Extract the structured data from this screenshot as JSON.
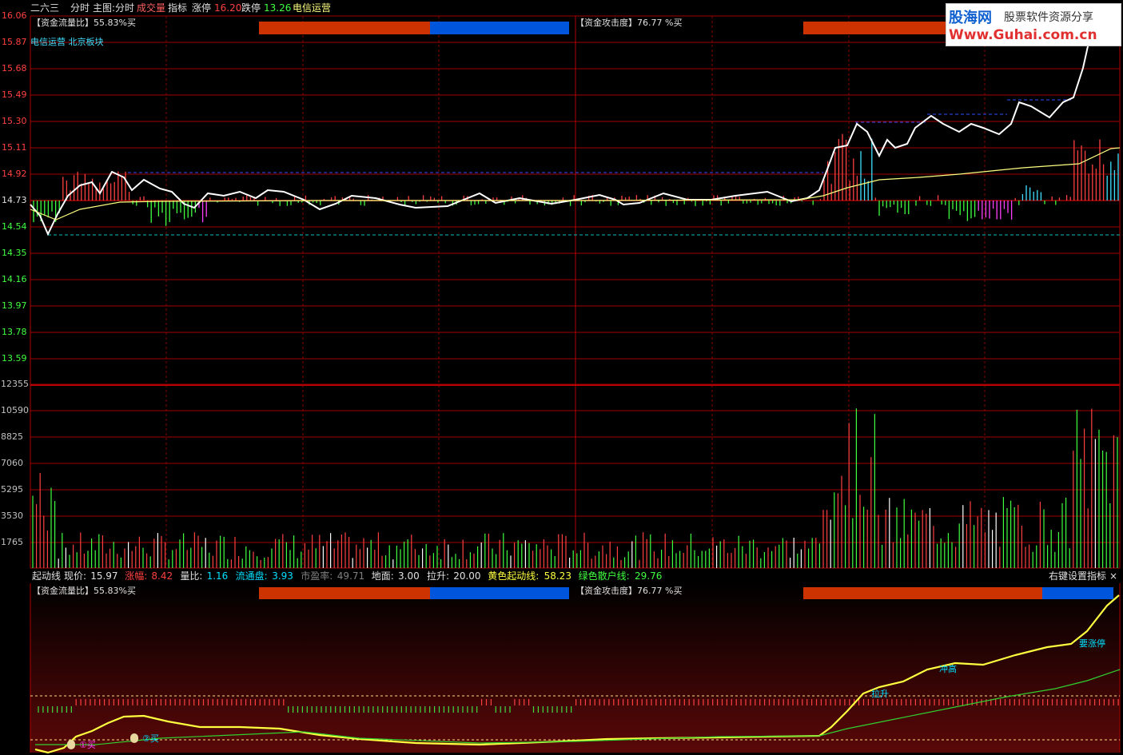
{
  "header": {
    "stock_name": "二六三",
    "mode": "分时",
    "main_chart": "主图:分时",
    "volume_word": "成交量",
    "indicator": "指标",
    "limit_up_label": "涨停",
    "limit_up_value": "16.20",
    "limit_down_label": "跌停",
    "limit_down_value": "13.26",
    "sector": "电信运营"
  },
  "price_panel": {
    "subtitle": "电信运营 北京板块",
    "ticks": [
      "16.06",
      "15.87",
      "15.68",
      "15.49",
      "15.30",
      "15.11",
      "14.92",
      "14.73",
      "14.54",
      "14.35",
      "14.16",
      "13.97",
      "13.78",
      "13.59"
    ],
    "flow_ratio_label": "【资金流量比】55.83%买",
    "attack_label": "【资金攻击度】76.77 %买"
  },
  "volume_panel": {
    "ticks": [
      "12355",
      "10590",
      "8825",
      "7060",
      "5295",
      "3530",
      "1765"
    ]
  },
  "indicator_bar": {
    "name": "起动线",
    "items": [
      {
        "label": "现价:",
        "value": "15.97",
        "label_color": "#e0e0e0",
        "value_color": "#e0e0e0"
      },
      {
        "label": "涨幅:",
        "value": "8.42",
        "label_color": "#ff4040",
        "value_color": "#ff4040"
      },
      {
        "label": "量比:",
        "value": "1.16",
        "label_color": "#e0e0e0",
        "value_color": "#00e0ff"
      },
      {
        "label": "流通盘:",
        "value": "3.93",
        "label_color": "#00e0ff",
        "value_color": "#00e0ff"
      },
      {
        "label": "市盈率:",
        "value": "49.71",
        "label_color": "#808080",
        "value_color": "#808080"
      },
      {
        "label": "地面:",
        "value": "3.00",
        "label_color": "#e0e0e0",
        "value_color": "#e0e0e0"
      },
      {
        "label": "拉升:",
        "value": "20.00",
        "label_color": "#e0e0e0",
        "value_color": "#e0e0e0"
      },
      {
        "label": "黄色起动线:",
        "value": "58.23",
        "label_color": "#ffff40",
        "value_color": "#ffff40"
      },
      {
        "label": "绿色散户线:",
        "value": "29.76",
        "label_color": "#40ff40",
        "value_color": "#40ff40"
      }
    ],
    "settings": "右键设置指标",
    "close": "×"
  },
  "lower_panel": {
    "flow_ratio_label": "【资金流量比】55.83%买",
    "attack_label": "【资金攻击度】76.77 %买",
    "annotations": {
      "buy1": "①买",
      "buy2": "②买",
      "pull_up": "拉升",
      "rush_high": "冲高",
      "limit_up": "要涨停"
    }
  },
  "watermark": {
    "brand": "股海网",
    "slogan": "股票软件资源分享",
    "url": "Www.Guhai.com.cn"
  },
  "colors": {
    "grid": "#a00000",
    "price_line": "#ffffff",
    "avg_line": "#ffff80",
    "up": "#ff4040",
    "down": "#40ff40",
    "bar_red": "#cc3300",
    "bar_blue": "#0055dd"
  }
}
